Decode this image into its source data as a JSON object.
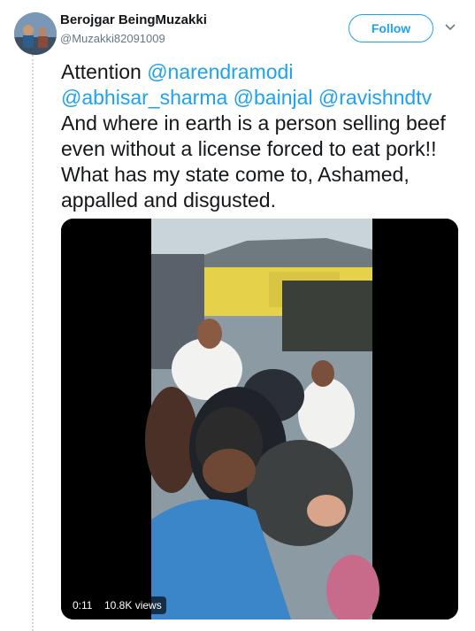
{
  "user": {
    "display_name": "Berojgar BeingMuzakki",
    "handle": "@Muzakki82091009"
  },
  "actions": {
    "follow_label": "Follow",
    "more_icon": "chevron-down-icon"
  },
  "tweet": {
    "text_line1_prefix": "Attention ",
    "mentions": [
      "@narendramodi",
      "@abhisar_sharma",
      "@bainjal",
      "@ravishndtv"
    ],
    "body": "And where in earth is a person selling beef even without a license forced to eat pork!! What has my state come to, Ashamed, appalled and disgusted."
  },
  "video": {
    "duration": "0:11",
    "views": "10.8K views"
  },
  "colors": {
    "accent": "#1da1f2",
    "text": "#14171a",
    "secondary": "#657786"
  }
}
